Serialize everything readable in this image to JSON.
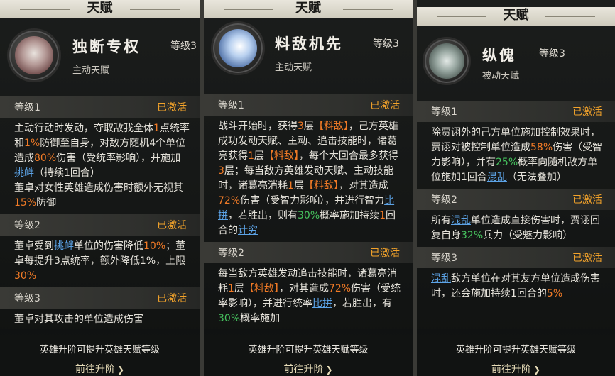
{
  "panels": [
    {
      "title": "天赋",
      "name": "独断专权",
      "level_tag": "等级3",
      "type": "主动天赋",
      "levels": [
        {
          "label": "等级1",
          "status": "已激活",
          "paragraphs": [
            [
              {
                "t": "主动行动时发动，夺取敌我全体"
              },
              {
                "t": "1",
                "c": "o"
              },
              {
                "t": "点统率和"
              },
              {
                "t": "1%",
                "c": "o"
              },
              {
                "t": "防御至自身，对敌方随机4个单位造成"
              },
              {
                "t": "80%",
                "c": "o"
              },
              {
                "t": "伤害（受统率影响），并施加"
              },
              {
                "t": "挑衅",
                "c": "b"
              },
              {
                "t": "（持续1回合）"
              }
            ],
            [
              {
                "t": "董卓对女性英雄造成伤害时额外无视其"
              },
              {
                "t": "15%",
                "c": "o"
              },
              {
                "t": "防御"
              }
            ]
          ]
        },
        {
          "label": "等级2",
          "status": "已激活",
          "paragraphs": [
            [
              {
                "t": "董卓受到"
              },
              {
                "t": "挑衅",
                "c": "b"
              },
              {
                "t": "单位的伤害降低"
              },
              {
                "t": "10%",
                "c": "o"
              },
              {
                "t": "；董卓每提升3点统率，额外降低1%，上限"
              },
              {
                "t": "30%",
                "c": "o"
              }
            ]
          ]
        },
        {
          "label": "等级3",
          "status": "已激活",
          "paragraphs": [
            [
              {
                "t": "董卓对其攻击的单位造成伤害"
              }
            ]
          ]
        }
      ],
      "footer_hint": "英雄升阶可提升英雄天赋等级",
      "footer_link": "前往升阶",
      "footer_arrow": "❯"
    },
    {
      "title": "天赋",
      "name": "料敌机先",
      "level_tag": "等级3",
      "type": "主动天赋",
      "levels": [
        {
          "label": "等级1",
          "status": "已激活",
          "paragraphs": [
            [
              {
                "t": "战斗开始时，获得"
              },
              {
                "t": "3",
                "c": "o"
              },
              {
                "t": "层"
              },
              {
                "t": "【料敌】",
                "c": "o"
              },
              {
                "t": "，己方英雄成功发动天赋、主动、追击技能时，诸葛亮获得"
              },
              {
                "t": "1",
                "c": "o"
              },
              {
                "t": "层"
              },
              {
                "t": "【料敌】",
                "c": "o"
              },
              {
                "t": "，每个大回合最多获得"
              },
              {
                "t": "3",
                "c": "o"
              },
              {
                "t": "层；每当敌方英雄发动天赋、主动技能时，诸葛亮消耗"
              },
              {
                "t": "1",
                "c": "o"
              },
              {
                "t": "层"
              },
              {
                "t": "【料敌】",
                "c": "o"
              },
              {
                "t": "，对其造成"
              },
              {
                "t": "72%",
                "c": "o"
              },
              {
                "t": "伤害（受智力影响），并进行智力"
              },
              {
                "t": "比拼",
                "c": "b"
              },
              {
                "t": "，若胜出，则有"
              },
              {
                "t": "30%",
                "c": "g"
              },
              {
                "t": "概率施加持续"
              },
              {
                "t": "1",
                "c": "o"
              },
              {
                "t": "回合的"
              },
              {
                "t": "计穷",
                "c": "b"
              }
            ]
          ]
        },
        {
          "label": "等级2",
          "status": "已激活",
          "paragraphs": [
            [
              {
                "t": "每当敌方英雄发动追击技能时，诸葛亮消耗"
              },
              {
                "t": "1",
                "c": "o"
              },
              {
                "t": "层"
              },
              {
                "t": "【料敌】",
                "c": "o"
              },
              {
                "t": "，对其造成"
              },
              {
                "t": "72%",
                "c": "o"
              },
              {
                "t": "伤害（受统率影响），并进行统率"
              },
              {
                "t": "比拼",
                "c": "b"
              },
              {
                "t": "，若胜出，有"
              },
              {
                "t": "30%",
                "c": "g"
              },
              {
                "t": "概率施加"
              }
            ]
          ]
        }
      ],
      "footer_hint": "英雄升阶可提升英雄天赋等级",
      "footer_link": "前往升阶",
      "footer_arrow": "❯"
    },
    {
      "title": "天赋",
      "name": "纵傀",
      "level_tag": "等级3",
      "type": "被动天赋",
      "levels": [
        {
          "label": "等级1",
          "status": "已激活",
          "paragraphs": [
            [
              {
                "t": "除贾诩外的己方单位施加控制效果时，贾诩对被控制单位造成"
              },
              {
                "t": "58%",
                "c": "o"
              },
              {
                "t": "伤害（受智力影响），并有"
              },
              {
                "t": "25%",
                "c": "g"
              },
              {
                "t": "概率向随机敌方单位施加1回合"
              },
              {
                "t": "混乱",
                "c": "b"
              },
              {
                "t": "（无法叠加）"
              }
            ]
          ]
        },
        {
          "label": "等级2",
          "status": "已激活",
          "paragraphs": [
            [
              {
                "t": "所有"
              },
              {
                "t": "混乱",
                "c": "b"
              },
              {
                "t": "单位造成直接伤害时，贾诩回复自身"
              },
              {
                "t": "32%",
                "c": "g"
              },
              {
                "t": "兵力（受魅力影响）"
              }
            ]
          ]
        },
        {
          "label": "等级3",
          "status": "已激活",
          "paragraphs": [
            [
              {
                "t": "混乱",
                "c": "b"
              },
              {
                "t": "敌方单位在对其友方单位造成伤害时，还会施加持续1回合的"
              },
              {
                "t": "5%",
                "c": "o"
              }
            ]
          ]
        }
      ],
      "footer_hint": "英雄升阶可提升英雄天赋等级",
      "footer_link": "前往升阶",
      "footer_arrow": "❯"
    }
  ]
}
